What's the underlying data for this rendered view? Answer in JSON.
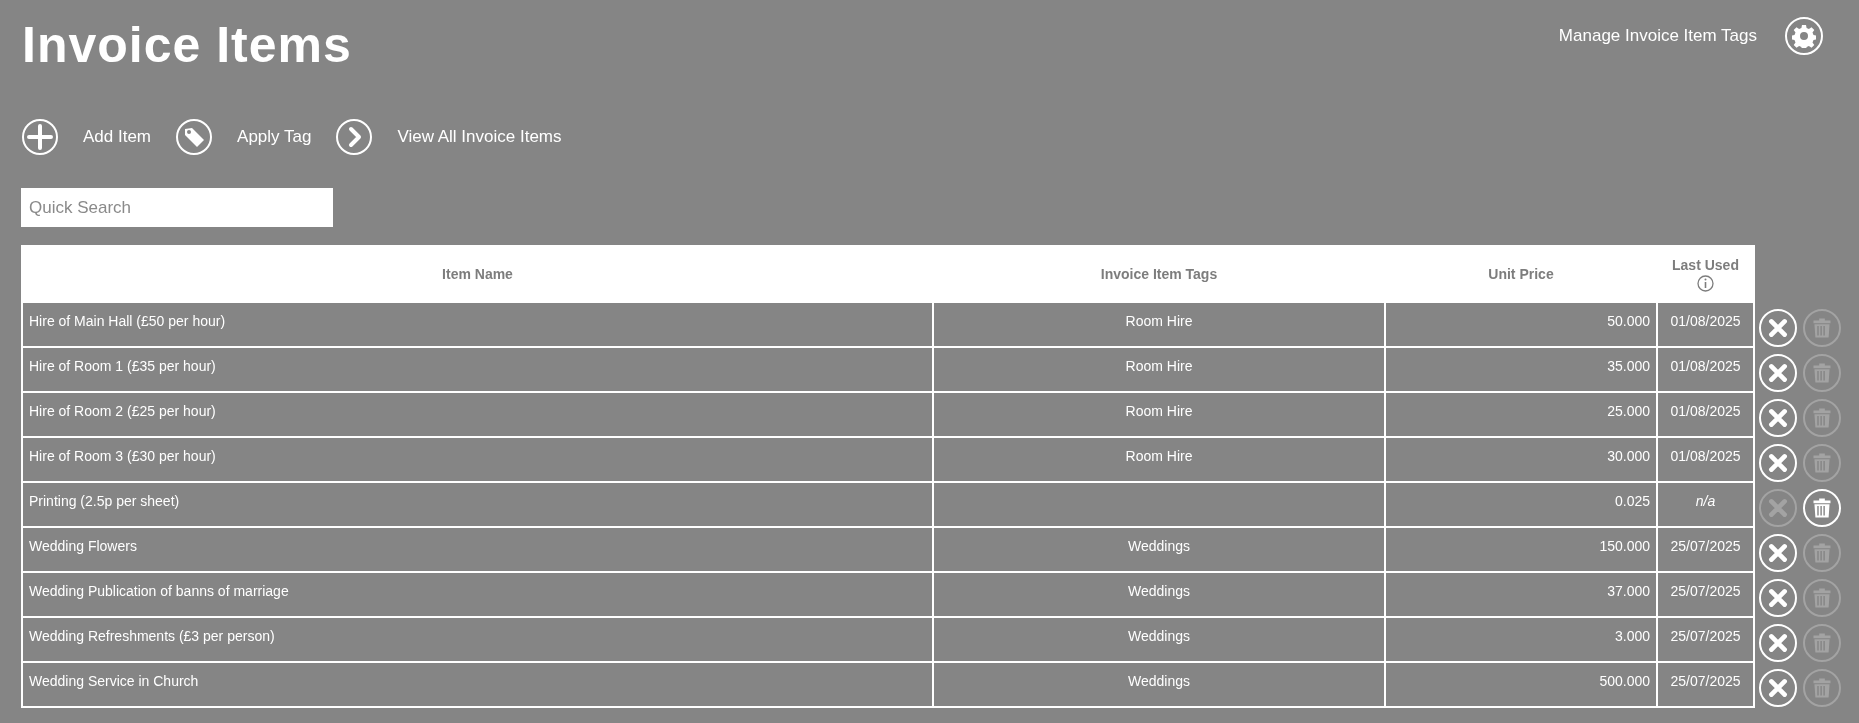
{
  "page": {
    "title": "Invoice Items",
    "manage_link": "Manage Invoice Item Tags"
  },
  "toolbar": [
    {
      "kind": "add",
      "label": "Add Item"
    },
    {
      "kind": "tag",
      "label": "Apply Tag"
    },
    {
      "kind": "view",
      "label": "View All Invoice Items"
    }
  ],
  "search": {
    "placeholder": "Quick Search"
  },
  "table": {
    "columns": [
      "Item Name",
      "Invoice Item Tags",
      "Unit Price",
      "Last Used"
    ],
    "rows": [
      {
        "name": "Hire of Main Hall (£50 per hour)",
        "tags": "Room Hire",
        "unit_price": "50.000",
        "last_used": "01/08/2025",
        "unused": false,
        "remove_disabled": false,
        "delete_disabled": true
      },
      {
        "name": "Hire of Room 1 (£35 per hour)",
        "tags": "Room Hire",
        "unit_price": "35.000",
        "last_used": "01/08/2025",
        "unused": false,
        "remove_disabled": false,
        "delete_disabled": true
      },
      {
        "name": "Hire of Room 2 (£25 per hour)",
        "tags": "Room Hire",
        "unit_price": "25.000",
        "last_used": "01/08/2025",
        "unused": false,
        "remove_disabled": false,
        "delete_disabled": true
      },
      {
        "name": "Hire of Room 3 (£30 per hour)",
        "tags": "Room Hire",
        "unit_price": "30.000",
        "last_used": "01/08/2025",
        "unused": false,
        "remove_disabled": false,
        "delete_disabled": true
      },
      {
        "name": "Printing (2.5p per sheet)",
        "tags": null,
        "unit_price": "0.025",
        "last_used": "n/a",
        "unused": true,
        "remove_disabled": true,
        "delete_disabled": false
      },
      {
        "name": "Wedding Flowers",
        "tags": "Weddings",
        "unit_price": "150.000",
        "last_used": "25/07/2025",
        "unused": false,
        "remove_disabled": false,
        "delete_disabled": true
      },
      {
        "name": "Wedding Publication of banns of marriage",
        "tags": "Weddings",
        "unit_price": "37.000",
        "last_used": "25/07/2025",
        "unused": false,
        "remove_disabled": false,
        "delete_disabled": true
      },
      {
        "name": "Wedding Refreshments (£3 per person)",
        "tags": "Weddings",
        "unit_price": "3.000",
        "last_used": "25/07/2025",
        "unused": false,
        "remove_disabled": false,
        "delete_disabled": true
      },
      {
        "name": "Wedding Service in Church",
        "tags": "Weddings",
        "unit_price": "500.000",
        "last_used": "25/07/2025",
        "unused": false,
        "remove_disabled": false,
        "delete_disabled": true
      }
    ]
  }
}
